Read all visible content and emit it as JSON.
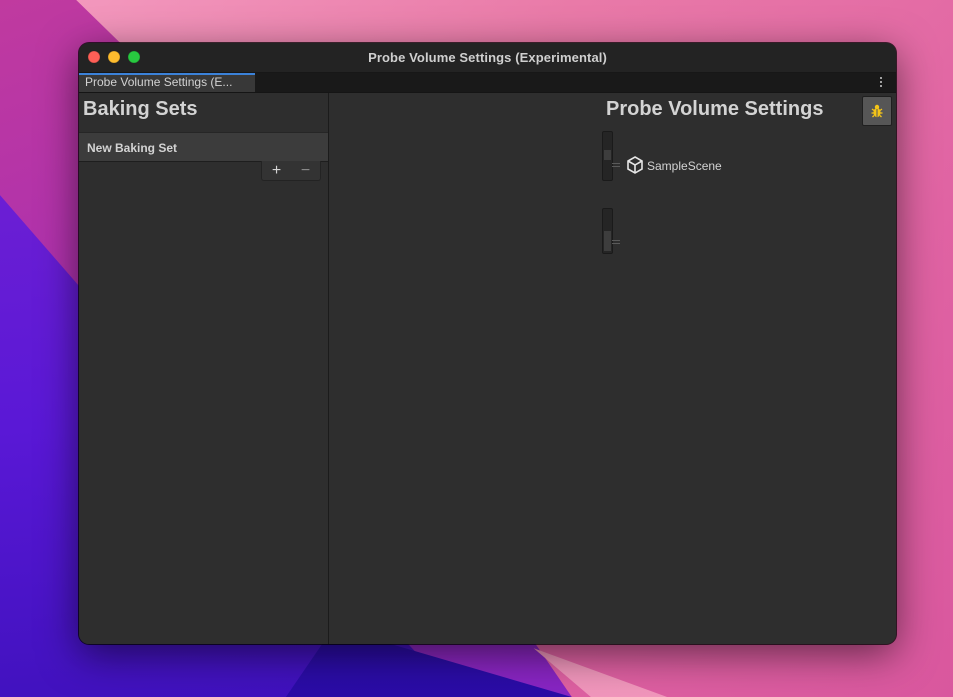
{
  "window": {
    "title": "Probe Volume Settings (Experimental)",
    "tab_label": "Probe Volume Settings (E..."
  },
  "left_pane": {
    "heading": "Baking Sets",
    "baking_sets": [
      {
        "name": "New Baking Set"
      }
    ],
    "add_label": "+",
    "remove_label": "−"
  },
  "right_pane": {
    "heading": "Probe Volume Settings",
    "debug_icon": "bug-icon",
    "scenes": [
      {
        "name": "SampleScene",
        "icon": "unity-scene-icon"
      }
    ]
  },
  "colors": {
    "accent_tab": "#3b82d9",
    "debug_icon": "#f5c518",
    "close": "#fe5f57",
    "minimize": "#febc2e",
    "maximize": "#28c840"
  }
}
